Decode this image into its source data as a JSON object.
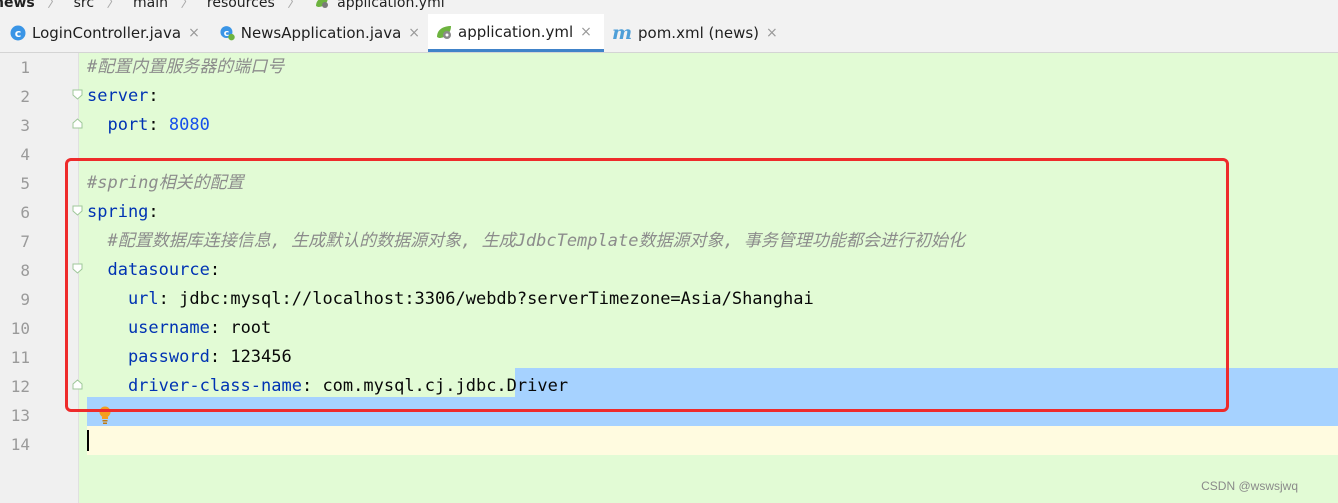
{
  "breadcrumb": [
    "news",
    "src",
    "main",
    "resources",
    "application.yml"
  ],
  "tabs": [
    {
      "label": "LoginController.java",
      "icon": "class-icon",
      "close": "×"
    },
    {
      "label": "NewsApplication.java",
      "icon": "spring-class-icon",
      "close": "×"
    },
    {
      "label": "application.yml",
      "icon": "spring-config-icon",
      "close": "×",
      "active": true
    },
    {
      "label": "pom.xml (news)",
      "icon_glyph": "m",
      "close": "×"
    }
  ],
  "editor": {
    "line_numbers": [
      "1",
      "2",
      "3",
      "4",
      "5",
      "6",
      "7",
      "8",
      "9",
      "10",
      "11",
      "12",
      "13",
      "14"
    ],
    "lines": {
      "l1_comment": "#配置内置服务器的端口号",
      "l2_key": "server",
      "l3_key": "  port",
      "l3_value": "8080",
      "l5_comment": "#spring相关的配置",
      "l6_key": "spring",
      "l7_comment": "  #配置数据库连接信息, 生成默认的数据源对象, 生成JdbcTemplate数据源对象, 事务管理功能都会进行初始化",
      "l8_key": "  datasource",
      "l9_key": "    url",
      "l9_value": "jdbc:mysql://localhost:3306/webdb?serverTimezone=Asia/Shanghai",
      "l10_key": "    username",
      "l10_value": "root",
      "l11_key": "    password",
      "l11_value": "123456",
      "l12_key": "    driver-class-name",
      "l12_value": "com.mysql.cj.jdbc.Driver"
    },
    "colon": ":"
  },
  "watermark": "CSDN @wswsjwq",
  "colors": {
    "editor_bg": "#e2fbd5",
    "key": "#0033b3",
    "number": "#1750eb",
    "comment": "#8c8c8c",
    "selection": "#a6d2ff",
    "annotation_box": "#ee2b2b",
    "active_tab_underline": "#4083c9"
  }
}
